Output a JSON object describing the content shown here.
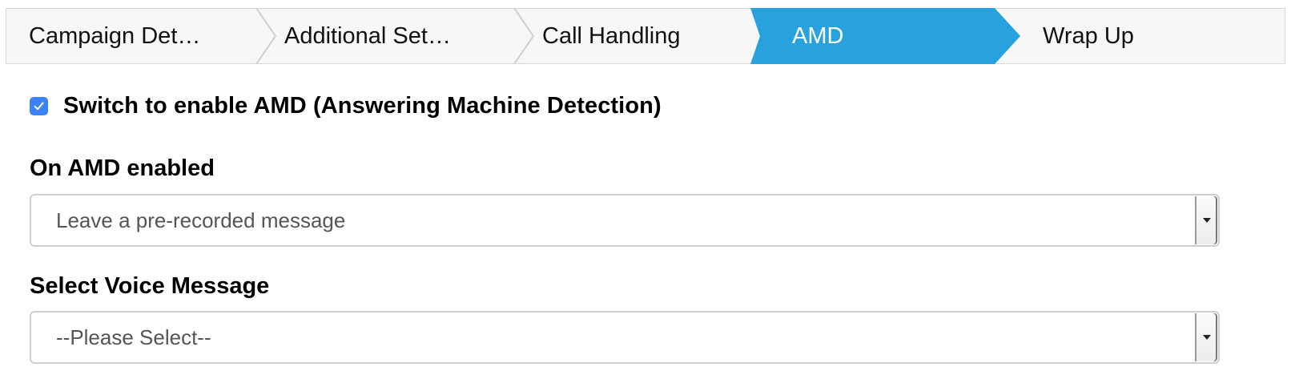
{
  "wizard": {
    "steps": [
      {
        "label": "Campaign Det…"
      },
      {
        "label": "Additional Set…"
      },
      {
        "label": "Call Handling"
      },
      {
        "label": "AMD",
        "active": true
      },
      {
        "label": "Wrap Up"
      }
    ]
  },
  "amd": {
    "checkbox_label": "Switch to enable AMD (Answering Machine Detection)",
    "checked": true
  },
  "on_amd_enabled": {
    "label": "On AMD enabled",
    "value": "Leave a pre-recorded message"
  },
  "voice_message": {
    "label": "Select Voice Message",
    "value": "--Please Select--"
  },
  "colors": {
    "active_step": "#27a2dd",
    "checkbox": "#3b82f6"
  }
}
